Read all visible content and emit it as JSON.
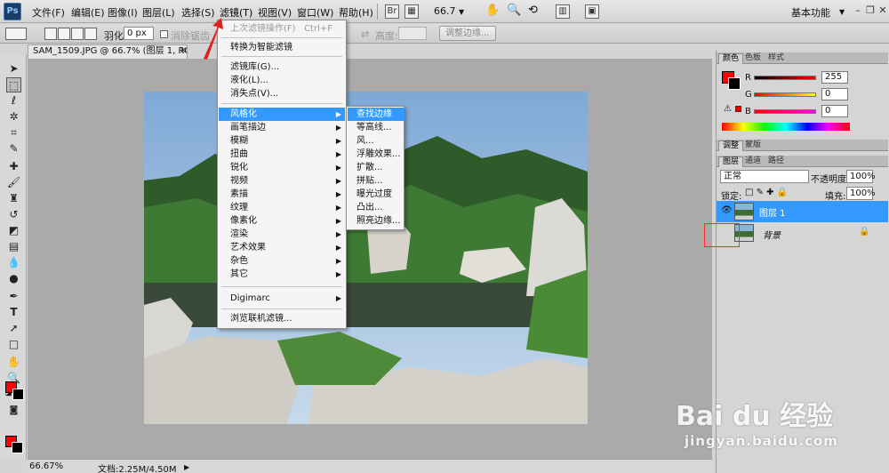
{
  "app": {
    "logo_text": "Ps",
    "workspace": "基本功能"
  },
  "menubar": {
    "items": [
      "文件(F)",
      "编辑(E)",
      "图像(I)",
      "图层(L)",
      "选择(S)",
      "滤镜(T)",
      "视图(V)",
      "窗口(W)",
      "帮助(H)"
    ],
    "zoom": "66.7"
  },
  "options": {
    "feather_label": "羽化:",
    "feather_value": "0 px",
    "antialias_label": "消除锯齿",
    "height_label": "高度:",
    "refine_edge": "调整边缘..."
  },
  "document": {
    "tab_title": "SAM_1509.JPG @ 66.7% (图层 1, RGB/8) *",
    "zoom_status": "66.67%",
    "doc_size": "文档:2.25M/4.50M"
  },
  "filter_menu": {
    "items": [
      {
        "label": "上次滤镜操作(F)",
        "shortcut": "Ctrl+F",
        "disabled": true
      },
      {
        "label": "转换为智能滤镜"
      },
      {
        "label": "滤镜库(G)..."
      },
      {
        "label": "液化(L)..."
      },
      {
        "label": "消失点(V)..."
      },
      {
        "label": "风格化",
        "sub": true,
        "highlighted": true
      },
      {
        "label": "画笔描边",
        "sub": true
      },
      {
        "label": "模糊",
        "sub": true
      },
      {
        "label": "扭曲",
        "sub": true
      },
      {
        "label": "锐化",
        "sub": true
      },
      {
        "label": "视频",
        "sub": true
      },
      {
        "label": "素描",
        "sub": true
      },
      {
        "label": "纹理",
        "sub": true
      },
      {
        "label": "像素化",
        "sub": true
      },
      {
        "label": "渲染",
        "sub": true
      },
      {
        "label": "艺术效果",
        "sub": true
      },
      {
        "label": "杂色",
        "sub": true
      },
      {
        "label": "其它",
        "sub": true
      },
      {
        "label": "Digimarc",
        "sub": true
      },
      {
        "label": "浏览联机滤镜..."
      }
    ]
  },
  "stylize_submenu": {
    "items": [
      "查找边缘",
      "等高线...",
      "风...",
      "浮雕效果...",
      "扩散...",
      "拼贴...",
      "曝光过度",
      "凸出...",
      "照亮边缘..."
    ]
  },
  "color_panel": {
    "tabs": [
      "颜色",
      "色板",
      "样式"
    ],
    "r_label": "R",
    "g_label": "G",
    "b_label": "B",
    "r_value": "255",
    "g_value": "0",
    "b_value": "0"
  },
  "adjust_tabs": [
    "调整",
    "蒙版"
  ],
  "layers_panel": {
    "tabs": [
      "图层",
      "通道",
      "路径"
    ],
    "blend_mode": "正常",
    "opacity_label": "不透明度:",
    "opacity_value": "100%",
    "lock_label": "锁定:",
    "fill_label": "填充:",
    "fill_value": "100%",
    "layers": [
      {
        "name": "图层 1",
        "selected": true
      },
      {
        "name": "背景",
        "locked": true
      }
    ]
  },
  "watermark": {
    "brand": "Bai du 经验",
    "url": "jingyan.baidu.com"
  },
  "colors": {
    "foreground": "#ff0000",
    "background": "#000000",
    "highlight": "#3399ff"
  }
}
